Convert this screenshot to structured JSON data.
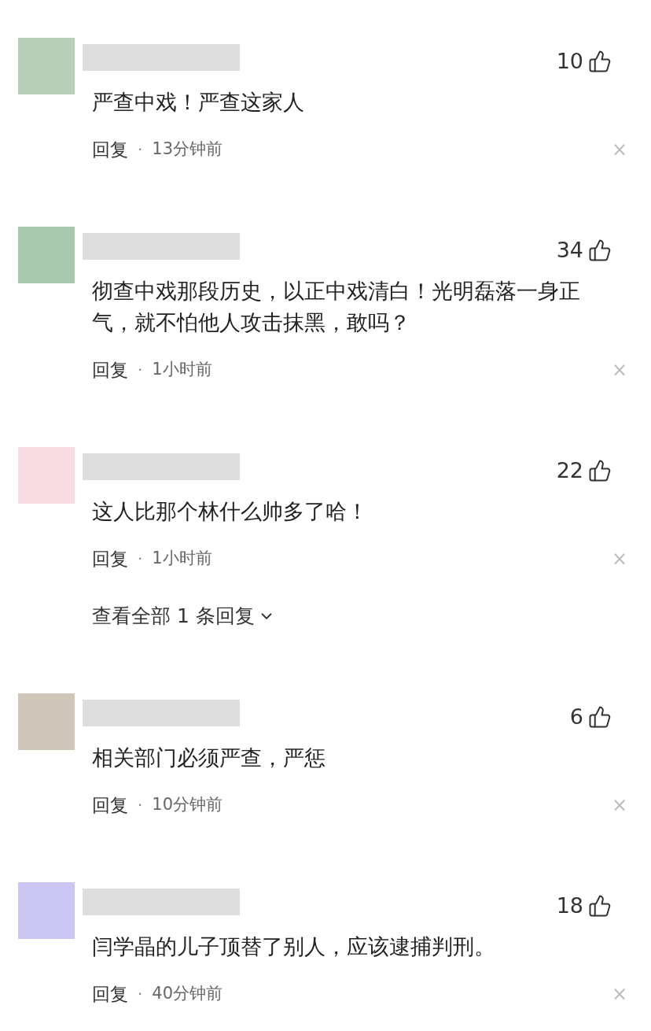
{
  "comments": [
    {
      "color": "#b7cfb8",
      "likes": "10",
      "text": "严查中戏！严查这家人",
      "reply": "回复",
      "separator": "·",
      "time": "13分钟前",
      "close": "×"
    },
    {
      "color": "#a9c9ae",
      "likes": "34",
      "text": "彻查中戏那段历史，以正中戏清白！光明磊落一身正气，就不怕他人攻击抹黑，敢吗？",
      "reply": "回复",
      "separator": "·",
      "time": "1小时前",
      "close": "×"
    },
    {
      "color": "#f8dde4",
      "likes": "22",
      "text": "这人比那个林什么帅多了哈！",
      "reply": "回复",
      "separator": "·",
      "time": "1小时前",
      "close": "×",
      "more_replies": "查看全部 1 条回复"
    },
    {
      "color": "#d0c6b9",
      "likes": "6",
      "text": "相关部门必须严查，严惩",
      "reply": "回复",
      "separator": "·",
      "time": "10分钟前",
      "close": "×"
    },
    {
      "color": "#cbc6f1",
      "likes": "18",
      "text": "闫学晶的儿子顶替了别人，应该逮捕判刑。",
      "reply": "回复",
      "separator": "·",
      "time": "40分钟前",
      "close": "×"
    }
  ]
}
